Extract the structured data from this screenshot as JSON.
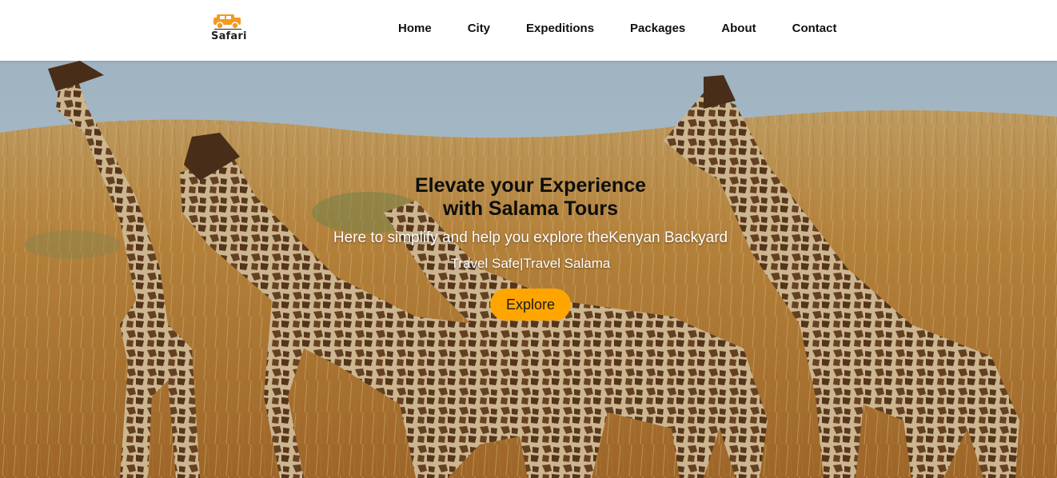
{
  "brand": {
    "logo_text": "Safari",
    "logo_icon": "jeep-icon",
    "accent_color": "#ffa500"
  },
  "nav": {
    "items": [
      {
        "label": "Home"
      },
      {
        "label": "City"
      },
      {
        "label": "Expeditions"
      },
      {
        "label": "Packages"
      },
      {
        "label": "About"
      },
      {
        "label": "Contact"
      }
    ]
  },
  "hero": {
    "title_line1": "Elevate your Experience",
    "title_line2": "with Salama Tours",
    "subtitle": "Here to simplify and help you explore theKenyan Backyard",
    "tagline": "Travel Safe|Travel Salama",
    "cta_label": "Explore",
    "background_image": "giraffes-savanna-photo",
    "cta_color": "#ffa500"
  }
}
